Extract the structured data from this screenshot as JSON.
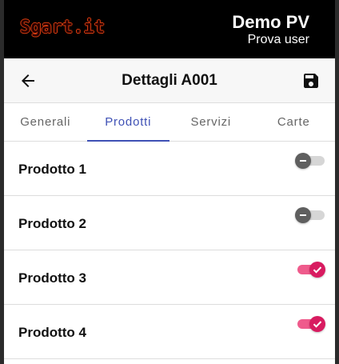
{
  "topbar": {
    "logo_text": "Sgart.it",
    "app_name": "Demo PV",
    "user_name": "Prova user"
  },
  "appbar": {
    "title": "Dettagli A001",
    "back_icon": "arrow-back-icon",
    "save_icon": "save-icon"
  },
  "tabs": [
    {
      "label": "Generali",
      "active": false
    },
    {
      "label": "Prodotti",
      "active": true
    },
    {
      "label": "Servizi",
      "active": false
    },
    {
      "label": "Carte",
      "active": false
    }
  ],
  "products": [
    {
      "label": "Prodotto 1",
      "enabled": false
    },
    {
      "label": "Prodotto 2",
      "enabled": false
    },
    {
      "label": "Prodotto 3",
      "enabled": true
    },
    {
      "label": "Prodotto 4",
      "enabled": true
    }
  ],
  "colors": {
    "accent": "#3f51b5",
    "toggle_on": "#d81b60",
    "toggle_off": "#5f5f5f"
  }
}
